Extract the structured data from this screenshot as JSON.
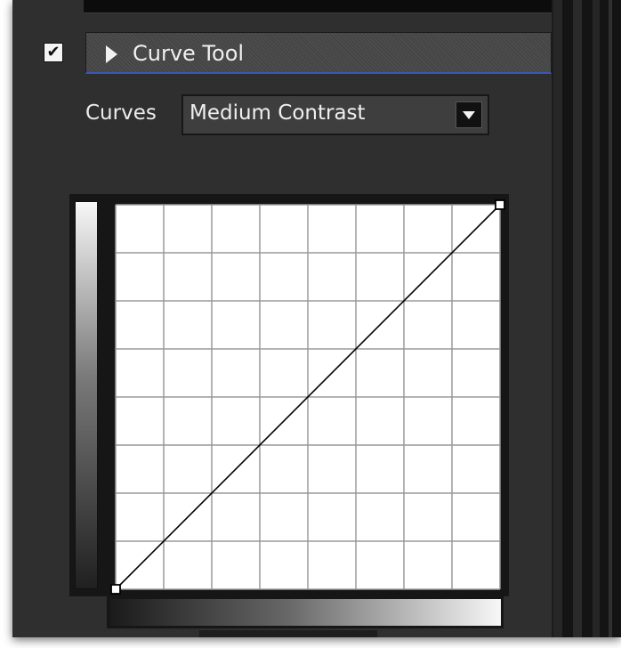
{
  "panel": {
    "enabled": true,
    "check_glyph": "✔",
    "title": "Curve Tool",
    "expand_icon": "triangle-right-icon"
  },
  "curves": {
    "label": "Curves",
    "selected": "Medium Contrast",
    "dropdown_icon": "chevron-down-icon"
  },
  "curve_editor": {
    "grid_divisions": 8,
    "points": [
      [
        0,
        0
      ],
      [
        1,
        1
      ]
    ],
    "colors": {
      "background": "#ffffff",
      "grid": "#9a9a9a",
      "curve": "#000000"
    }
  }
}
